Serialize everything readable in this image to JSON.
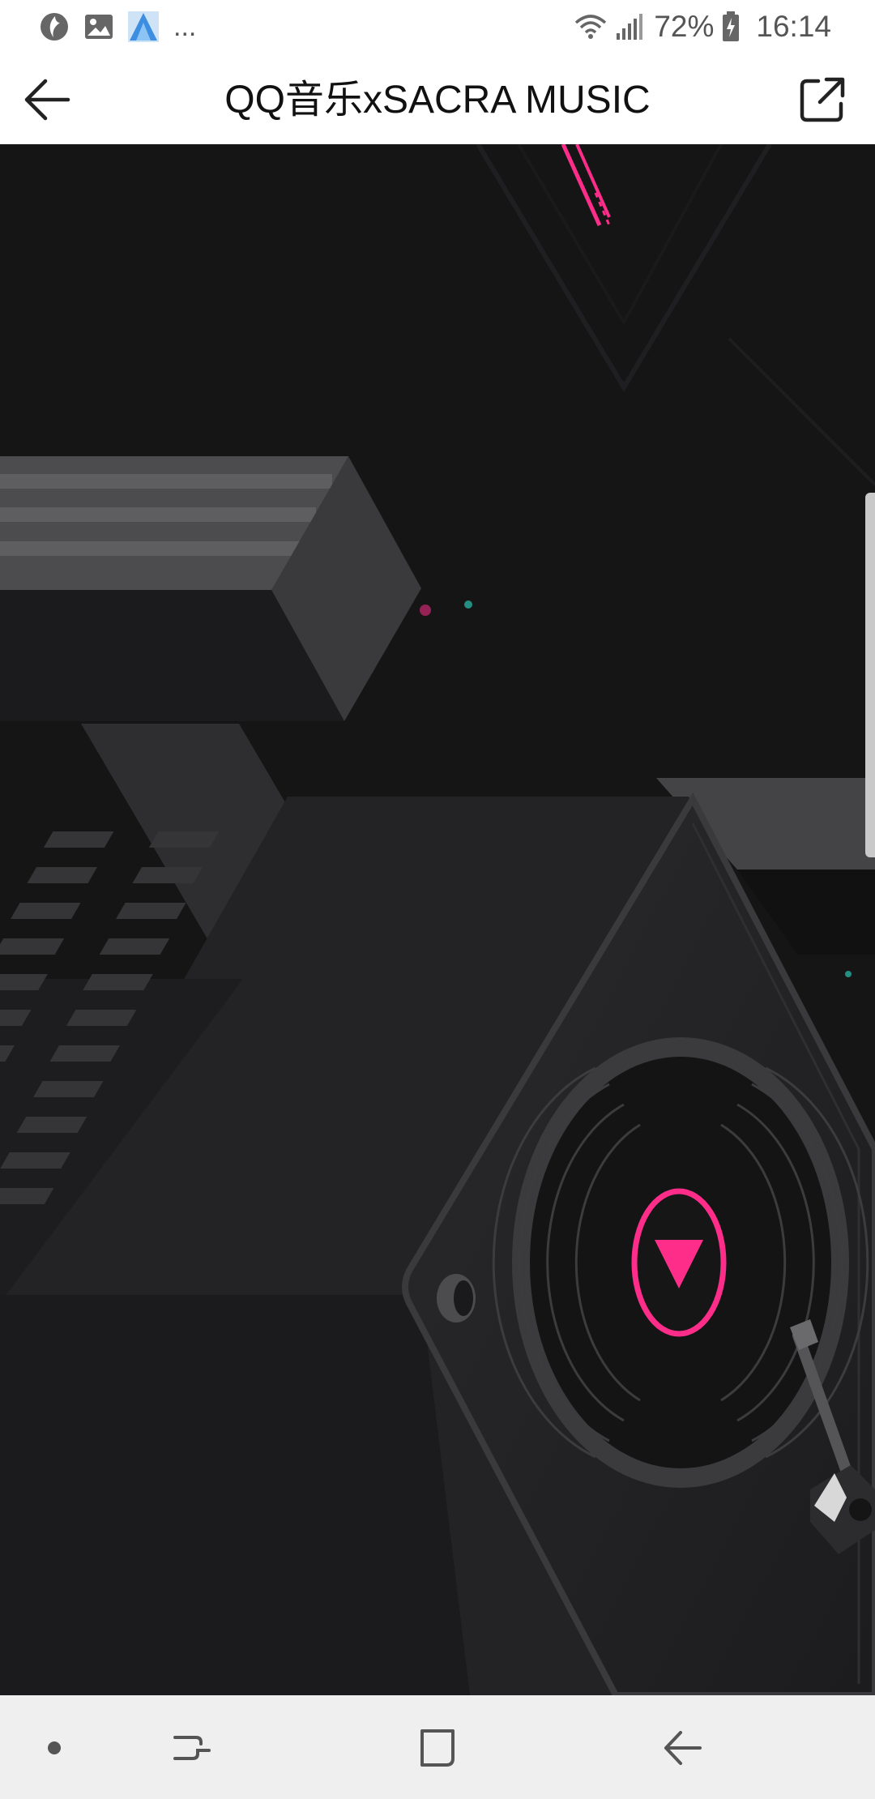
{
  "status_bar": {
    "battery_percent": "72%",
    "time": "16:14",
    "overflow": "..."
  },
  "app_bar": {
    "title": "QQ音乐xSACRA MUSIC"
  },
  "colors": {
    "accent_pink": "#ff2d8a",
    "background_dark": "#151516"
  }
}
